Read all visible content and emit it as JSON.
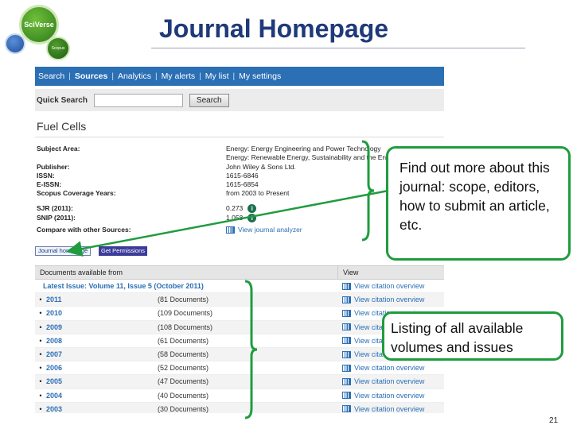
{
  "logos": {
    "sciverse": "SciVerse",
    "scopus": "Scopus"
  },
  "slide": {
    "title": "Journal Homepage",
    "page_number": "21"
  },
  "nav": {
    "items": [
      "Search",
      "Sources",
      "Analytics",
      "My alerts",
      "My list",
      "My settings"
    ],
    "active": "Sources"
  },
  "quick_search": {
    "label": "Quick Search",
    "value": "",
    "button": "Search"
  },
  "source": {
    "title": "Fuel Cells",
    "rows": [
      {
        "label": "Subject Area:",
        "value": "Energy: Energy Engineering and Power Technology"
      },
      {
        "label": "",
        "value": "Energy: Renewable Energy, Sustainability and the Environment"
      },
      {
        "label": "Publisher:",
        "value": "John Wiley & Sons Ltd."
      },
      {
        "label": "ISSN:",
        "value": "1615-6846"
      },
      {
        "label": "E-ISSN:",
        "value": "1615-6854"
      },
      {
        "label": "Scopus Coverage Years:",
        "value": "from 2003 to Present"
      },
      {
        "label": "SJR (2011):",
        "value": "0.273"
      },
      {
        "label": "SNIP (2011):",
        "value": "1.058"
      },
      {
        "label": "Compare with other Sources:",
        "value": "View journal analyzer"
      }
    ],
    "journal_homepage_button": "Journal homepage",
    "permissions_button": "Get Permissions"
  },
  "documents": {
    "headers": [
      "Documents available from",
      "View"
    ],
    "latest_issue": "Latest Issue: Volume 11, Issue 5 (October 2011)",
    "view_link": "View citation overview",
    "rows": [
      {
        "year": "2011",
        "count": "(81 Documents)"
      },
      {
        "year": "2010",
        "count": "(109 Documents)"
      },
      {
        "year": "2009",
        "count": "(108 Documents)"
      },
      {
        "year": "2008",
        "count": "(61 Documents)"
      },
      {
        "year": "2007",
        "count": "(58 Documents)"
      },
      {
        "year": "2006",
        "count": "(52 Documents)"
      },
      {
        "year": "2005",
        "count": "(47 Documents)"
      },
      {
        "year": "2004",
        "count": "(40 Documents)"
      },
      {
        "year": "2003",
        "count": "(30 Documents)"
      }
    ]
  },
  "callouts": {
    "about": "Find out more about this journal: scope, editors, how to submit an article, etc.",
    "listing": "Listing of all available volumes and issues"
  },
  "colors": {
    "accent_green": "#1f9c3e",
    "title_blue": "#1f3a7a",
    "nav_blue": "#2b6fb4"
  }
}
